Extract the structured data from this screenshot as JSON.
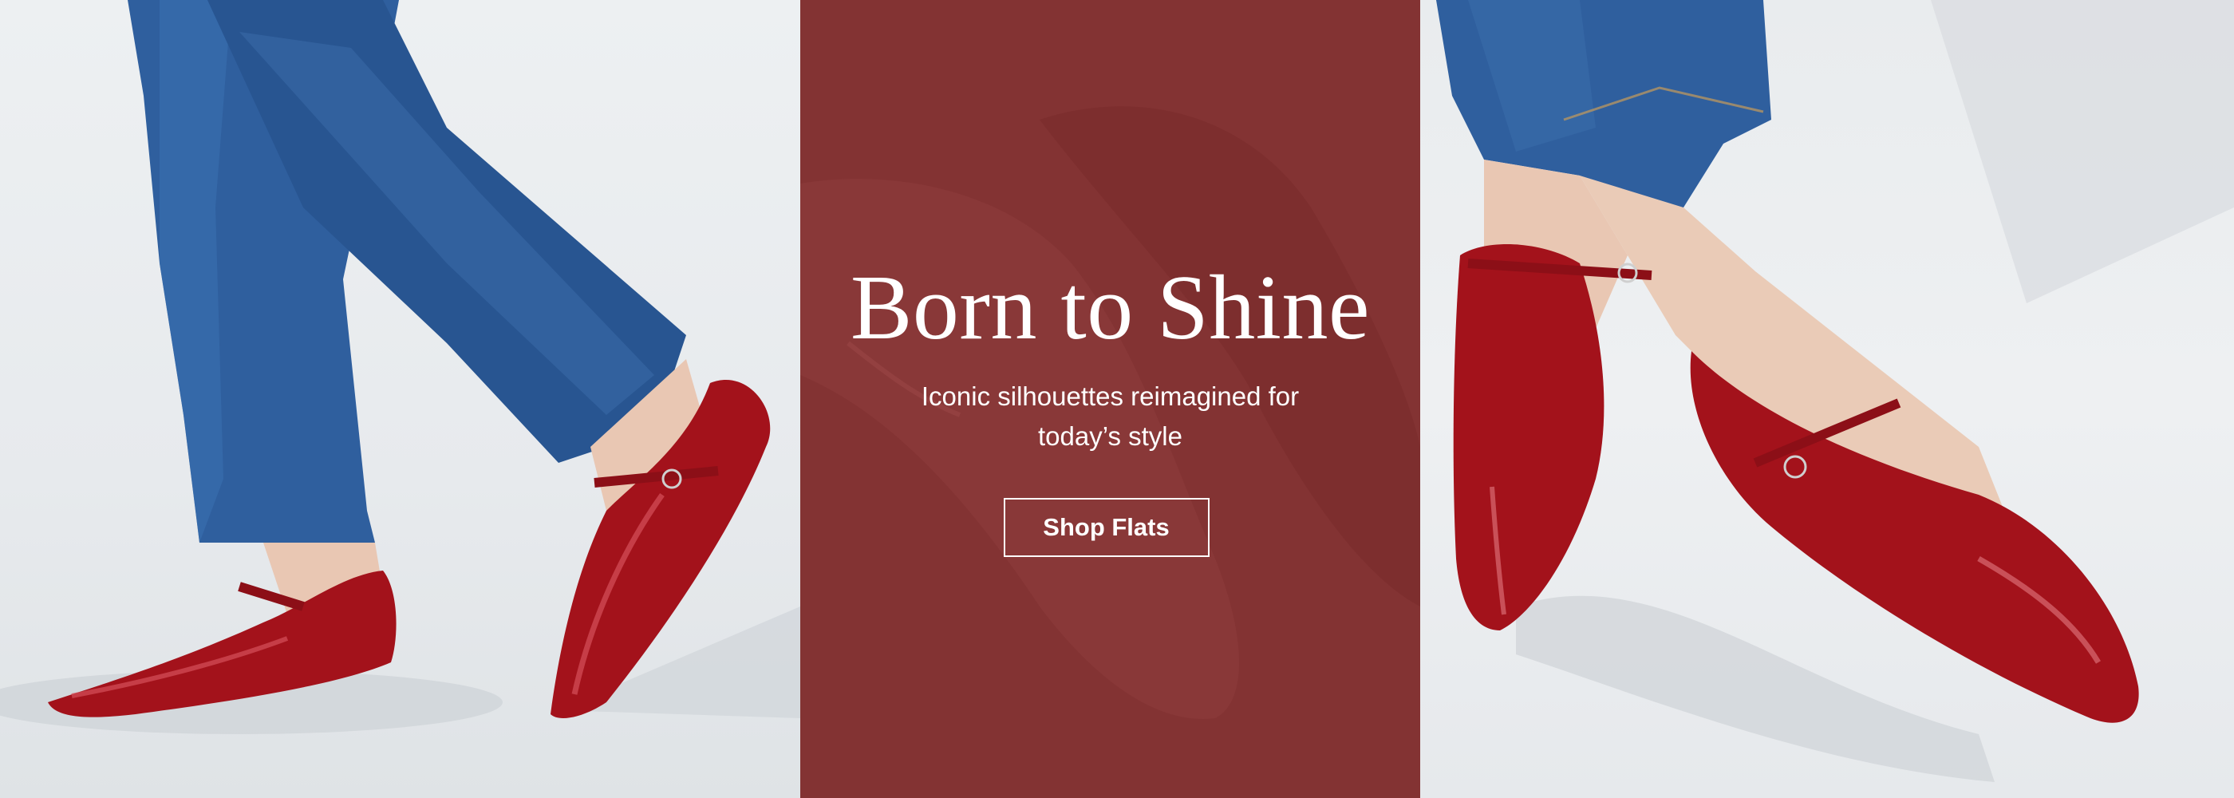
{
  "hero": {
    "headline": "Born to Shine",
    "subheadline": "Iconic silhouettes reimagined for today’s style",
    "cta_label": "Shop Flats"
  },
  "colors": {
    "center_panel": "#833333",
    "shoe_red": "#a3121b",
    "denim": "#2f5f9e",
    "text": "#ffffff"
  }
}
